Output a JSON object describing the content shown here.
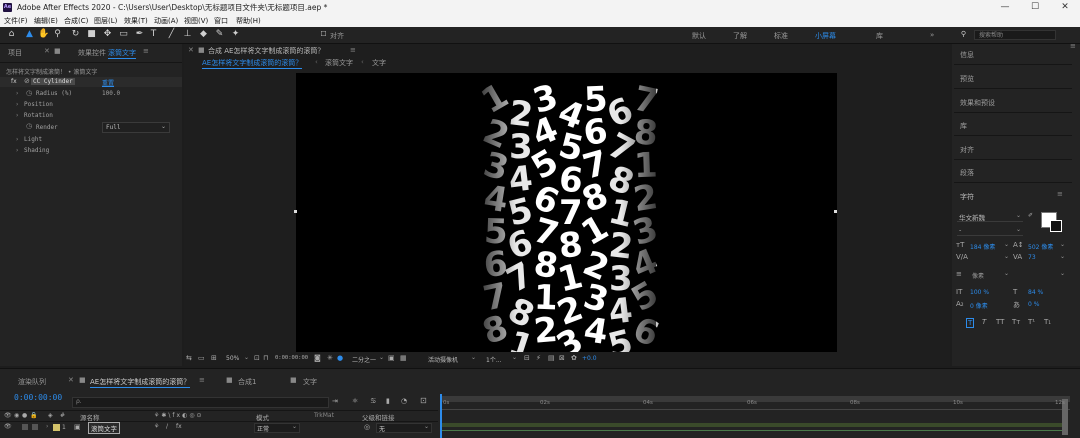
{
  "window": {
    "title": "Adobe After Effects 2020 - C:\\Users\\User\\Desktop\\无标题项目文件夹\\无标题项目.aep *",
    "app_icon": "Ae",
    "minimize": "—",
    "maximize": "☐",
    "close": "✕"
  },
  "menu": [
    "文件(F)",
    "编辑(E)",
    "合成(C)",
    "图层(L)",
    "效果(T)",
    "动画(A)",
    "视图(V)",
    "窗口",
    "帮助(H)"
  ],
  "toolbar": {
    "snap_label": "对齐",
    "workspaces": [
      "默认",
      "了解",
      "标准",
      "小屏幕",
      "库"
    ],
    "active_workspace": "小屏幕",
    "search_placeholder": "搜索帮助",
    "expand": "»"
  },
  "left_panel": {
    "tab_project": "项目",
    "tab_effects": "效果控件",
    "tab_effects_target": "滚筒文字",
    "breadcrumb": "怎样将文字制成滚筒！ • 滚筒文字",
    "effect_name": "CC Cylinder",
    "reset_label": "重置",
    "properties": [
      {
        "label": "Radius (%)",
        "value": "100.0"
      },
      {
        "label": "Position",
        "value": ""
      },
      {
        "label": "Rotation",
        "value": ""
      },
      {
        "label": "Render",
        "value": "Full"
      },
      {
        "label": "Light",
        "value": ""
      },
      {
        "label": "Shading",
        "value": ""
      }
    ]
  },
  "comp_panel": {
    "tab_title": "合成 AE怎样将文字制成滚筒的滚筒？",
    "path": [
      "AE怎样将文字制成滚筒的滚筒？",
      "滚筒文字",
      "文字"
    ],
    "zoom": "50%",
    "timecode": "0:00:00:00",
    "resolution": "二分之一",
    "camera": "活动摄像机",
    "views": "1个...",
    "exposure": "+0.0"
  },
  "right_panel": {
    "items": [
      "信息",
      "预览",
      "效果和预设",
      "库",
      "对齐",
      "段落",
      "字符"
    ],
    "font": "华文新魏",
    "font_style": "-",
    "font_size": "184 像素",
    "leading": "502 像素",
    "tracking": "73",
    "stroke": "像素",
    "vscale": "100 %",
    "hscale": "84 %",
    "baseline": "0 像素",
    "tsume": "0 %",
    "style_buttons": [
      "T",
      "T",
      "TT",
      "Tт",
      "T¹",
      "T₁"
    ]
  },
  "timeline": {
    "tab_render": "渲染队列",
    "tab_main": "AE怎样将文字制成滚筒的滚筒？",
    "tab_comp1": "合成1",
    "tab_text": "文字",
    "timecode": "0:00:00:00",
    "search_placeholder": "ρ.",
    "col_name": "源名称",
    "col_mode": "模式",
    "col_trkmat": "TrkMat",
    "col_parent": "父级和链接",
    "layer_number": "1",
    "layer_name": "滚筒文字",
    "layer_mode": "正常",
    "layer_parent": "无",
    "ruler": [
      "0s",
      "02s",
      "04s",
      "06s",
      "08s",
      "10s",
      "12s"
    ]
  },
  "canvas_digits": [
    "1",
    "2",
    "3",
    "4",
    "5",
    "6",
    "7",
    "8",
    "1",
    "2",
    "3",
    "4",
    "5",
    "6",
    "7",
    "8"
  ]
}
